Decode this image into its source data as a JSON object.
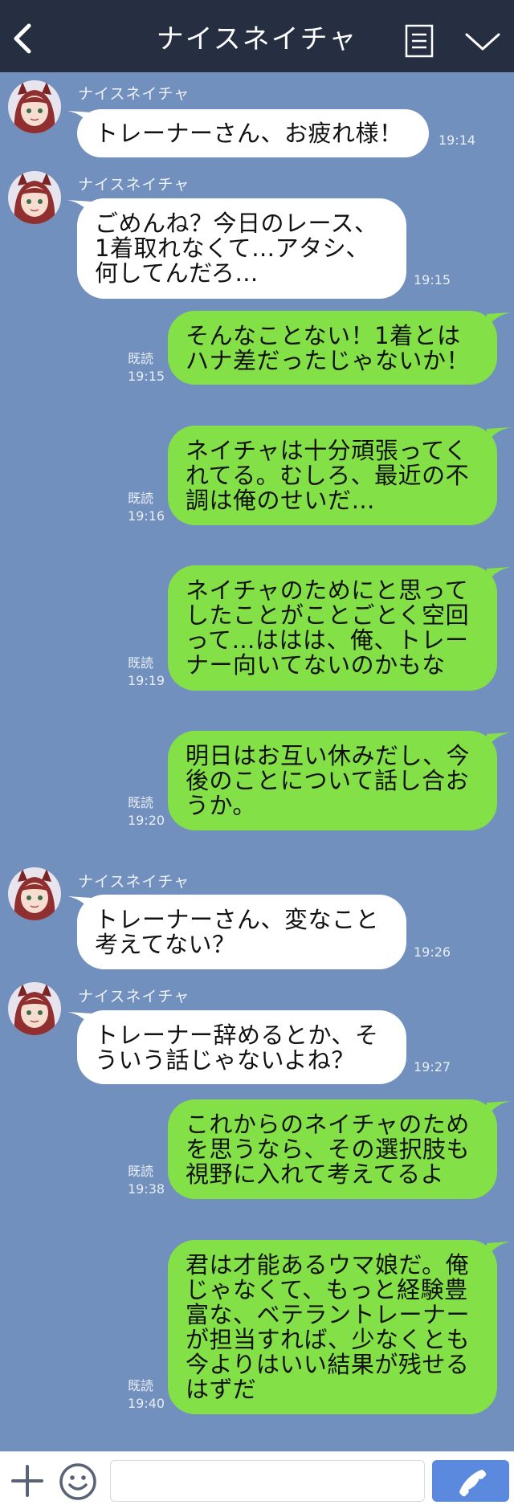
{
  "header": {
    "title": "ナイスネイチャ",
    "back_icon": "chevron-left-icon",
    "menu_icon": "note-list-icon",
    "expand_icon": "chevron-down-icon"
  },
  "colors": {
    "header_bg": "#262f42",
    "chat_bg": "#7290bd",
    "incoming_bubble": "#ffffff",
    "outgoing_bubble": "#84e047",
    "call_button": "#5b89de"
  },
  "messages": [
    {
      "dir": "in",
      "sender": "ナイスネイチャ",
      "text": "トレーナーさん、お疲れ様！",
      "time": "19:14"
    },
    {
      "dir": "in",
      "sender": "ナイスネイチャ",
      "text": "ごめんね？今日のレース、1着取れなくて…アタシ、何してんだろ…",
      "time": "19:15"
    },
    {
      "dir": "out",
      "read": "既読",
      "text": "そんなことない！1着とはハナ差だったじゃないか！",
      "time": "19:15"
    },
    {
      "dir": "out",
      "read": "既読",
      "text": "ネイチャは十分頑張ってくれてる。むしろ、最近の不調は俺のせいだ…",
      "time": "19:16"
    },
    {
      "dir": "out",
      "read": "既読",
      "text": "ネイチャのためにと思ってしたことがことごとく空回って…ははは、俺、トレーナー向いてないのかもな",
      "time": "19:19"
    },
    {
      "dir": "out",
      "read": "既読",
      "text": "明日はお互い休みだし、今後のことについて話し合おうか。",
      "time": "19:20"
    },
    {
      "dir": "in",
      "sender": "ナイスネイチャ",
      "text": "トレーナーさん、変なこと考えてない？",
      "time": "19:26"
    },
    {
      "dir": "in",
      "sender": "ナイスネイチャ",
      "text": "トレーナー辞めるとか、そういう話じゃないよね？",
      "time": "19:27"
    },
    {
      "dir": "out",
      "read": "既読",
      "text": "これからのネイチャのためを思うなら、その選択肢も視野に入れて考えてるよ",
      "time": "19:38"
    },
    {
      "dir": "out",
      "read": "既読",
      "text": "君は才能あるウマ娘だ。俺じゃなくて、もっと経験豊富な、ベテラントレーナーが担当すれば、少なくとも今よりはいい結果が残せるはずだ",
      "time": "19:40"
    }
  ],
  "footer": {
    "plus_icon": "plus-icon",
    "emoji_icon": "smiley-icon",
    "input_value": "",
    "call_icon": "phone-icon"
  }
}
